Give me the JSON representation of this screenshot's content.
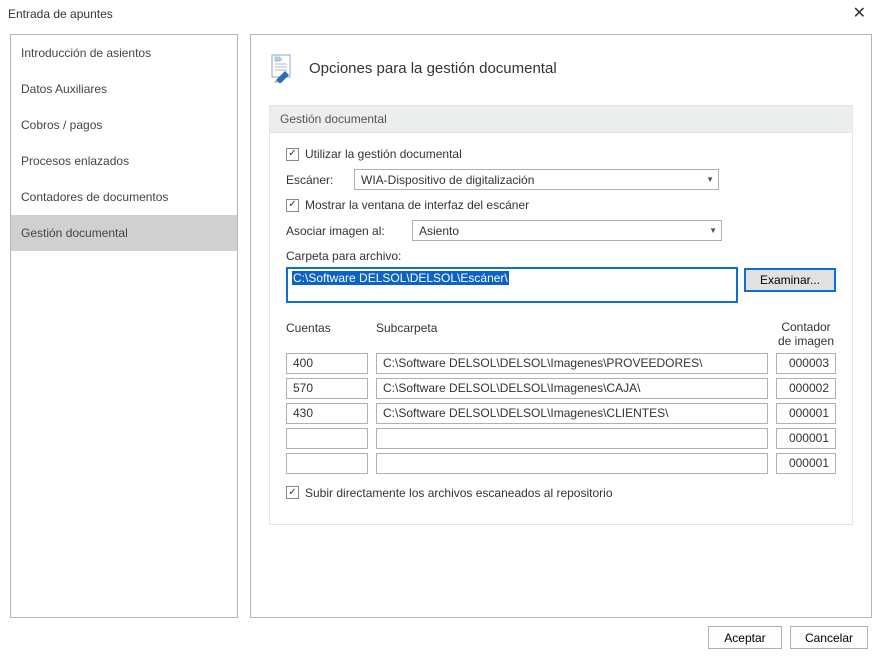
{
  "window": {
    "title": "Entrada de apuntes"
  },
  "sidebar": {
    "items": [
      {
        "label": "Introducción de asientos"
      },
      {
        "label": "Datos Auxiliares"
      },
      {
        "label": "Cobros / pagos"
      },
      {
        "label": "Procesos enlazados"
      },
      {
        "label": "Contadores de documentos"
      },
      {
        "label": "Gestión documental"
      }
    ],
    "selected_index": 5
  },
  "main": {
    "heading": "Opciones para la gestión documental",
    "group_title": "Gestión documental",
    "use_doc_mgmt": {
      "label": "Utilizar la gestión documental",
      "checked": true
    },
    "scanner": {
      "label": "Escáner:",
      "value": "WIA-Dispositivo de digitalización"
    },
    "show_scanner_ui": {
      "label": "Mostrar la ventana de interfaz del escáner",
      "checked": true
    },
    "associate": {
      "label": "Asociar imagen al:",
      "value": "Asiento"
    },
    "folder": {
      "label": "Carpeta para archivo:",
      "value": "C:\\Software DELSOL\\DELSOL\\Escáner\\",
      "browse": "Examinar..."
    },
    "table": {
      "headers": {
        "cuentas": "Cuentas",
        "subcarpeta": "Subcarpeta",
        "contador": "Contador de imagen"
      },
      "rows": [
        {
          "cuenta": "400",
          "sub": "C:\\Software DELSOL\\DELSOL\\Imagenes\\PROVEEDORES\\",
          "contador": "000003"
        },
        {
          "cuenta": "570",
          "sub": "C:\\Software DELSOL\\DELSOL\\Imagenes\\CAJA\\",
          "contador": "000002"
        },
        {
          "cuenta": "430",
          "sub": "C:\\Software DELSOL\\DELSOL\\Imagenes\\CLIENTES\\",
          "contador": "000001"
        },
        {
          "cuenta": "",
          "sub": "",
          "contador": "000001"
        },
        {
          "cuenta": "",
          "sub": "",
          "contador": "000001"
        }
      ]
    },
    "upload_direct": {
      "label": "Subir directamente los archivos escaneados al repositorio",
      "checked": true
    }
  },
  "buttons": {
    "accept": "Aceptar",
    "cancel": "Cancelar"
  }
}
